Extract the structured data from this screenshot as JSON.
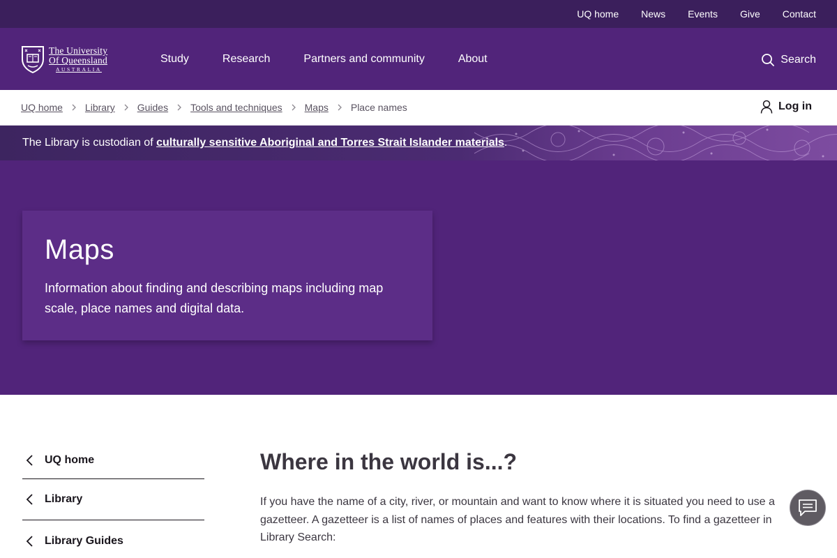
{
  "utility_nav": [
    "UQ home",
    "News",
    "Events",
    "Give",
    "Contact"
  ],
  "logo": {
    "line1": "The University",
    "line2": "Of Queensland",
    "line3": "AUSTRALIA"
  },
  "main_nav": [
    "Study",
    "Research",
    "Partners and community",
    "About"
  ],
  "search_label": "Search",
  "breadcrumb": {
    "links": [
      "UQ home",
      "Library",
      "Guides",
      "Tools and techniques",
      "Maps"
    ],
    "current": "Place names"
  },
  "login_label": "Log in",
  "acknowledgement": {
    "prefix": "The Library is custodian of ",
    "link": "culturally sensitive Aboriginal and Torres Strait Islander materials",
    "suffix": "."
  },
  "hero": {
    "title": "Maps",
    "description": "Information about finding and describing maps including map scale, place names and digital data."
  },
  "side_nav": [
    "UQ home",
    "Library",
    "Library Guides"
  ],
  "article": {
    "heading": "Where in the world is...?",
    "paragraph": "If you have the name of a city, river, or mountain and want to know where it is situated you need to use a gazetteer. A gazetteer is a list of names of places and features with their locations. To find a gazetteer in Library Search:"
  },
  "colors": {
    "uq_purple": "#51247a",
    "utility_bar": "#3b1f5c",
    "hero_card": "#5c2d87",
    "chat_button": "#5f5b62"
  },
  "icons": [
    "search-icon",
    "user-icon",
    "chevron-right-icon",
    "chevron-left-icon",
    "chat-icon",
    "uq-crest-icon"
  ]
}
